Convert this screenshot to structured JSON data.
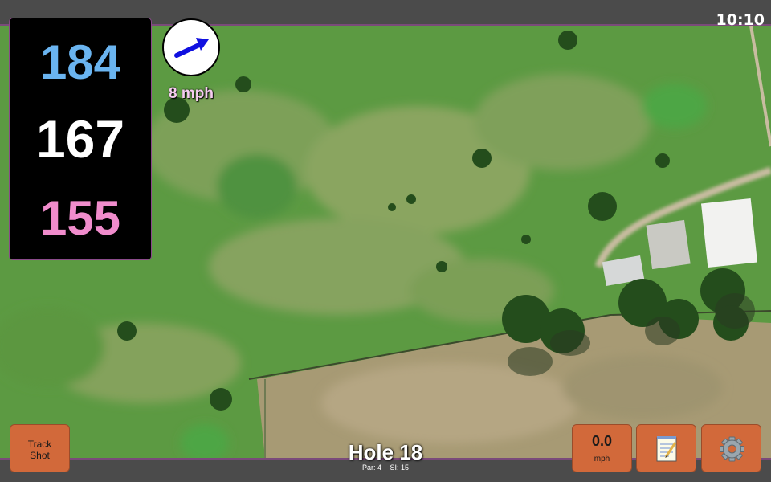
{
  "status_bar": {
    "time": "10:10"
  },
  "distances": {
    "back": "184",
    "middle": "167",
    "front": "155"
  },
  "wind": {
    "speed_label": "8 mph",
    "arrow_icon": "wind-direction-arrow-icon",
    "arrow_color": "#1010e0"
  },
  "buttons": {
    "track_shot": [
      "Track",
      "Shot"
    ],
    "wind_speed_value": "0.0",
    "wind_speed_unit": "mph",
    "notes_icon": "notepad-icon",
    "settings_icon": "gear-icon",
    "button_color": "#d2693a"
  },
  "hole": {
    "title": "Hole 18",
    "par": "Par: 4",
    "si": "SI: 15"
  },
  "colors": {
    "back_distance": "#6ab4f0",
    "middle_distance": "#ffffff",
    "front_distance": "#f08ccc",
    "bars": "#4b4b4b"
  }
}
